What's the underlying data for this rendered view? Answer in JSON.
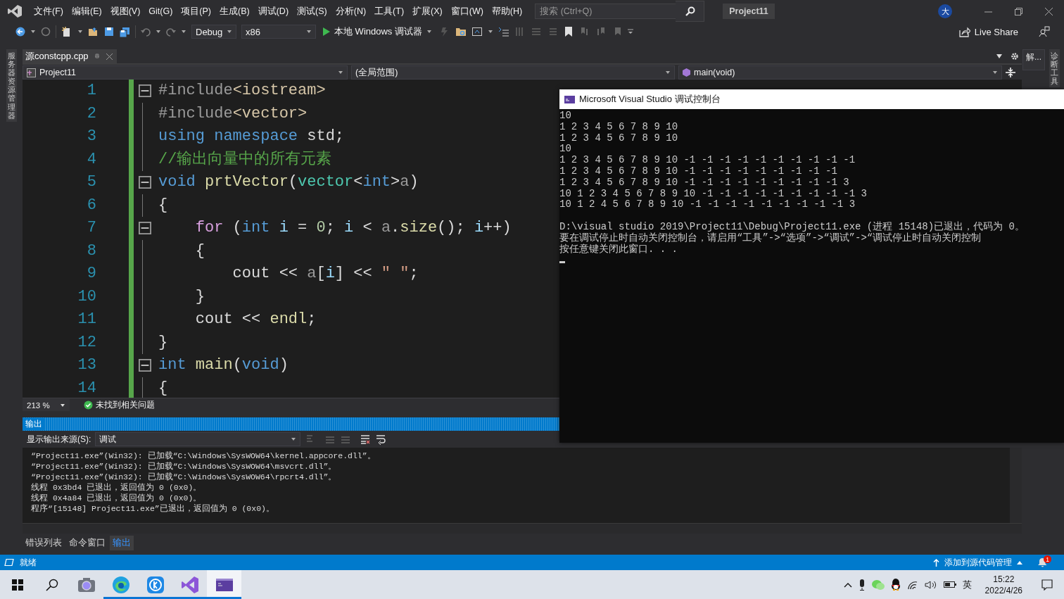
{
  "menu_bar": {
    "menus": [
      "文件(F)",
      "编辑(E)",
      "视图(V)",
      "Git(G)",
      "项目(P)",
      "生成(B)",
      "调试(D)",
      "测试(S)",
      "分析(N)",
      "工具(T)",
      "扩展(X)",
      "窗口(W)",
      "帮助(H)"
    ],
    "search": {
      "placeholder": "搜索 (Ctrl+Q)"
    },
    "solution_name": "Project11",
    "account_initial": "大"
  },
  "toolbar": {
    "configuration": "Debug",
    "platform": "x86",
    "run_target": "本地 Windows 调试器",
    "live_share": "Live Share"
  },
  "left_sidebar": {
    "tabs": [
      "服务器资源管理器"
    ]
  },
  "document_tabs": [
    {
      "label": "源constcpp.cpp",
      "selected": true
    }
  ],
  "navigation_bar": {
    "project": "Project11",
    "scope": "(全局范围)",
    "member": "main(void)"
  },
  "editor": {
    "lines": [
      {
        "number": "1",
        "fold_start": true,
        "tokens": [
          {
            "kind": "preprocessor",
            "text": "#include"
          },
          {
            "kind": "header",
            "text": "<iostream>"
          }
        ]
      },
      {
        "number": "2",
        "fold_start": false,
        "tokens": [
          {
            "kind": "preprocessor",
            "text": "#include"
          },
          {
            "kind": "header",
            "text": "<vector>"
          }
        ]
      },
      {
        "number": "3",
        "fold_start": false,
        "tokens": [
          {
            "kind": "keyword",
            "text": "using namespace"
          },
          {
            "kind": "plain",
            "text": " std;"
          }
        ]
      },
      {
        "number": "4",
        "fold_start": false,
        "tokens": [
          {
            "kind": "comment",
            "text": "//输出向量中的所有元素"
          }
        ]
      },
      {
        "number": "5",
        "fold_start": true,
        "tokens": [
          {
            "kind": "keyword",
            "text": "void"
          },
          {
            "kind": "function",
            "text": " prtVector"
          },
          {
            "kind": "plain",
            "text": "("
          },
          {
            "kind": "type",
            "text": "vector"
          },
          {
            "kind": "plain",
            "text": "<"
          },
          {
            "kind": "keyword",
            "text": "int"
          },
          {
            "kind": "plain",
            "text": ">"
          },
          {
            "kind": "parameter",
            "text": "a"
          },
          {
            "kind": "plain",
            "text": ")"
          }
        ]
      },
      {
        "number": "6",
        "fold_start": false,
        "tokens": [
          {
            "kind": "plain",
            "text": "{"
          }
        ]
      },
      {
        "number": "7",
        "fold_start": true,
        "tokens": [
          {
            "kind": "control",
            "text": "    for"
          },
          {
            "kind": "plain",
            "text": " ("
          },
          {
            "kind": "keyword",
            "text": "int"
          },
          {
            "kind": "variable",
            "text": " i"
          },
          {
            "kind": "plain",
            "text": " = "
          },
          {
            "kind": "number",
            "text": "0"
          },
          {
            "kind": "plain",
            "text": "; "
          },
          {
            "kind": "variable",
            "text": "i"
          },
          {
            "kind": "plain",
            "text": " < "
          },
          {
            "kind": "parameter",
            "text": "a"
          },
          {
            "kind": "plain",
            "text": "."
          },
          {
            "kind": "function",
            "text": "size"
          },
          {
            "kind": "plain",
            "text": "(); "
          },
          {
            "kind": "variable",
            "text": "i"
          },
          {
            "kind": "plain",
            "text": "++)"
          }
        ]
      },
      {
        "number": "8",
        "fold_start": false,
        "tokens": [
          {
            "kind": "plain",
            "text": "    {"
          }
        ]
      },
      {
        "number": "9",
        "fold_start": false,
        "tokens": [
          {
            "kind": "plain",
            "text": "        cout << "
          },
          {
            "kind": "parameter",
            "text": "a"
          },
          {
            "kind": "plain",
            "text": "["
          },
          {
            "kind": "variable",
            "text": "i"
          },
          {
            "kind": "plain",
            "text": "] << "
          },
          {
            "kind": "string",
            "text": "\" \""
          },
          {
            "kind": "plain",
            "text": ";"
          }
        ]
      },
      {
        "number": "10",
        "fold_start": false,
        "tokens": [
          {
            "kind": "plain",
            "text": "    }"
          }
        ]
      },
      {
        "number": "11",
        "fold_start": false,
        "tokens": [
          {
            "kind": "plain",
            "text": "    cout << "
          },
          {
            "kind": "function",
            "text": "endl"
          },
          {
            "kind": "plain",
            "text": ";"
          }
        ]
      },
      {
        "number": "12",
        "fold_start": false,
        "tokens": [
          {
            "kind": "plain",
            "text": "}"
          }
        ]
      },
      {
        "number": "13",
        "fold_start": true,
        "tokens": [
          {
            "kind": "keyword",
            "text": "int"
          },
          {
            "kind": "function",
            "text": " main"
          },
          {
            "kind": "plain",
            "text": "("
          },
          {
            "kind": "keyword",
            "text": "void"
          },
          {
            "kind": "plain",
            "text": ")"
          }
        ]
      },
      {
        "number": "14",
        "fold_start": false,
        "tokens": [
          {
            "kind": "plain",
            "text": "{"
          }
        ]
      }
    ],
    "zoom": "213 %",
    "issues": "未找到相关问题"
  },
  "right_sidebar": {
    "panel_tab": "解...",
    "tabs": [
      "诊断工具"
    ]
  },
  "output_panel": {
    "title": "输出",
    "source_label": "显示输出来源(S):",
    "source": "调试",
    "lines": [
      "“Project11.exe”(Win32): 已加载“C:\\Windows\\SysWOW64\\kernel.appcore.dll”。",
      "“Project11.exe”(Win32): 已加载“C:\\Windows\\SysWOW64\\msvcrt.dll”。",
      "“Project11.exe”(Win32): 已加载“C:\\Windows\\SysWOW64\\rpcrt4.dll”。",
      "线程 0x3bd4 已退出，返回值为 0 (0x0)。",
      "线程 0x4a84 已退出，返回值为 0 (0x0)。",
      "程序“[15148] Project11.exe”已退出，返回值为 0 (0x0)。"
    ],
    "tabs": [
      {
        "label": "错误列表",
        "selected": false
      },
      {
        "label": "命令窗口",
        "selected": false
      },
      {
        "label": "输出",
        "selected": true
      }
    ]
  },
  "status_bar": {
    "state": "就绪",
    "source_control": "添加到源代码管理",
    "notification_count": "1"
  },
  "taskbar": {
    "apps": [
      {
        "kind": "camera",
        "running": false,
        "selected": false
      },
      {
        "kind": "browser",
        "running": true,
        "selected": false
      },
      {
        "kind": "music",
        "running": true,
        "selected": false
      },
      {
        "kind": "ide",
        "running": true,
        "selected": false
      },
      {
        "kind": "console",
        "running": true,
        "selected": true
      }
    ],
    "ime": "英",
    "time": "15:22",
    "date": "2022/4/26"
  },
  "console_window": {
    "title": "Microsoft Visual Studio 调试控制台",
    "blocks": [
      [
        "10",
        "1 2 3 4 5 6 7 8 9 10",
        "1 2 3 4 5 6 7 8 9 10",
        "10",
        "1 2 3 4 5 6 7 8 9 10 -1 -1 -1 -1 -1 -1 -1 -1 -1 -1",
        "1 2 3 4 5 6 7 8 9 10 -1 -1 -1 -1 -1 -1 -1 -1 -1",
        "1 2 3 4 5 6 7 8 9 10 -1 -1 -1 -1 -1 -1 -1 -1 -1 3",
        "10 1 2 3 4 5 6 7 8 9 10 -1 -1 -1 -1 -1 -1 -1 -1 -1 3",
        "10 1 2 4 5 6 7 8 9 10 -1 -1 -1 -1 -1 -1 -1 -1 -1 3"
      ],
      [
        "D:\\visual studio 2019\\Project11\\Debug\\Project11.exe (进程 15148)已退出，代码为 0。",
        "要在调试停止时自动关闭控制台，请启用“工具”->“选项”->“调试”->“调试停止时自动关闭控制",
        "按任意键关闭此窗口. . ."
      ]
    ]
  }
}
